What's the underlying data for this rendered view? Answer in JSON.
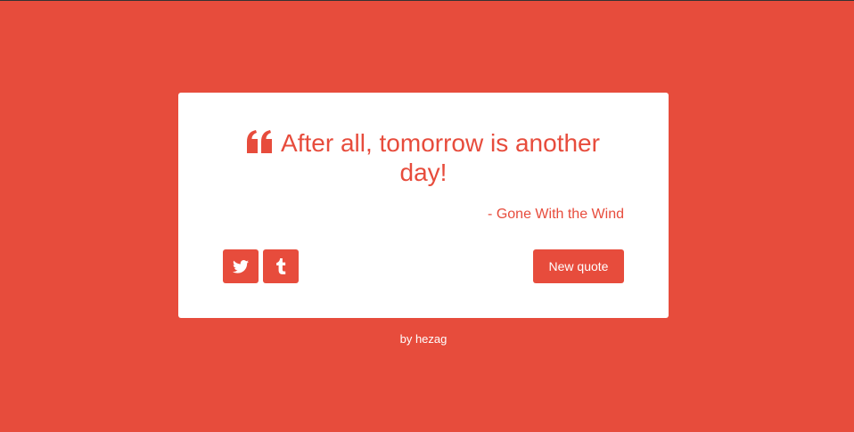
{
  "quote": {
    "text": "After all, tomorrow is another day!",
    "author": "- Gone With the Wind",
    "icon": "quote-left-icon"
  },
  "share": {
    "twitter_icon": "twitter-icon",
    "tumblr_icon": "tumblr-icon"
  },
  "actions": {
    "new_quote_label": "New quote"
  },
  "footer": {
    "credit": "by hezag"
  },
  "colors": {
    "accent": "#e74c3c",
    "card": "#ffffff",
    "footer_text": "#ffffff"
  }
}
